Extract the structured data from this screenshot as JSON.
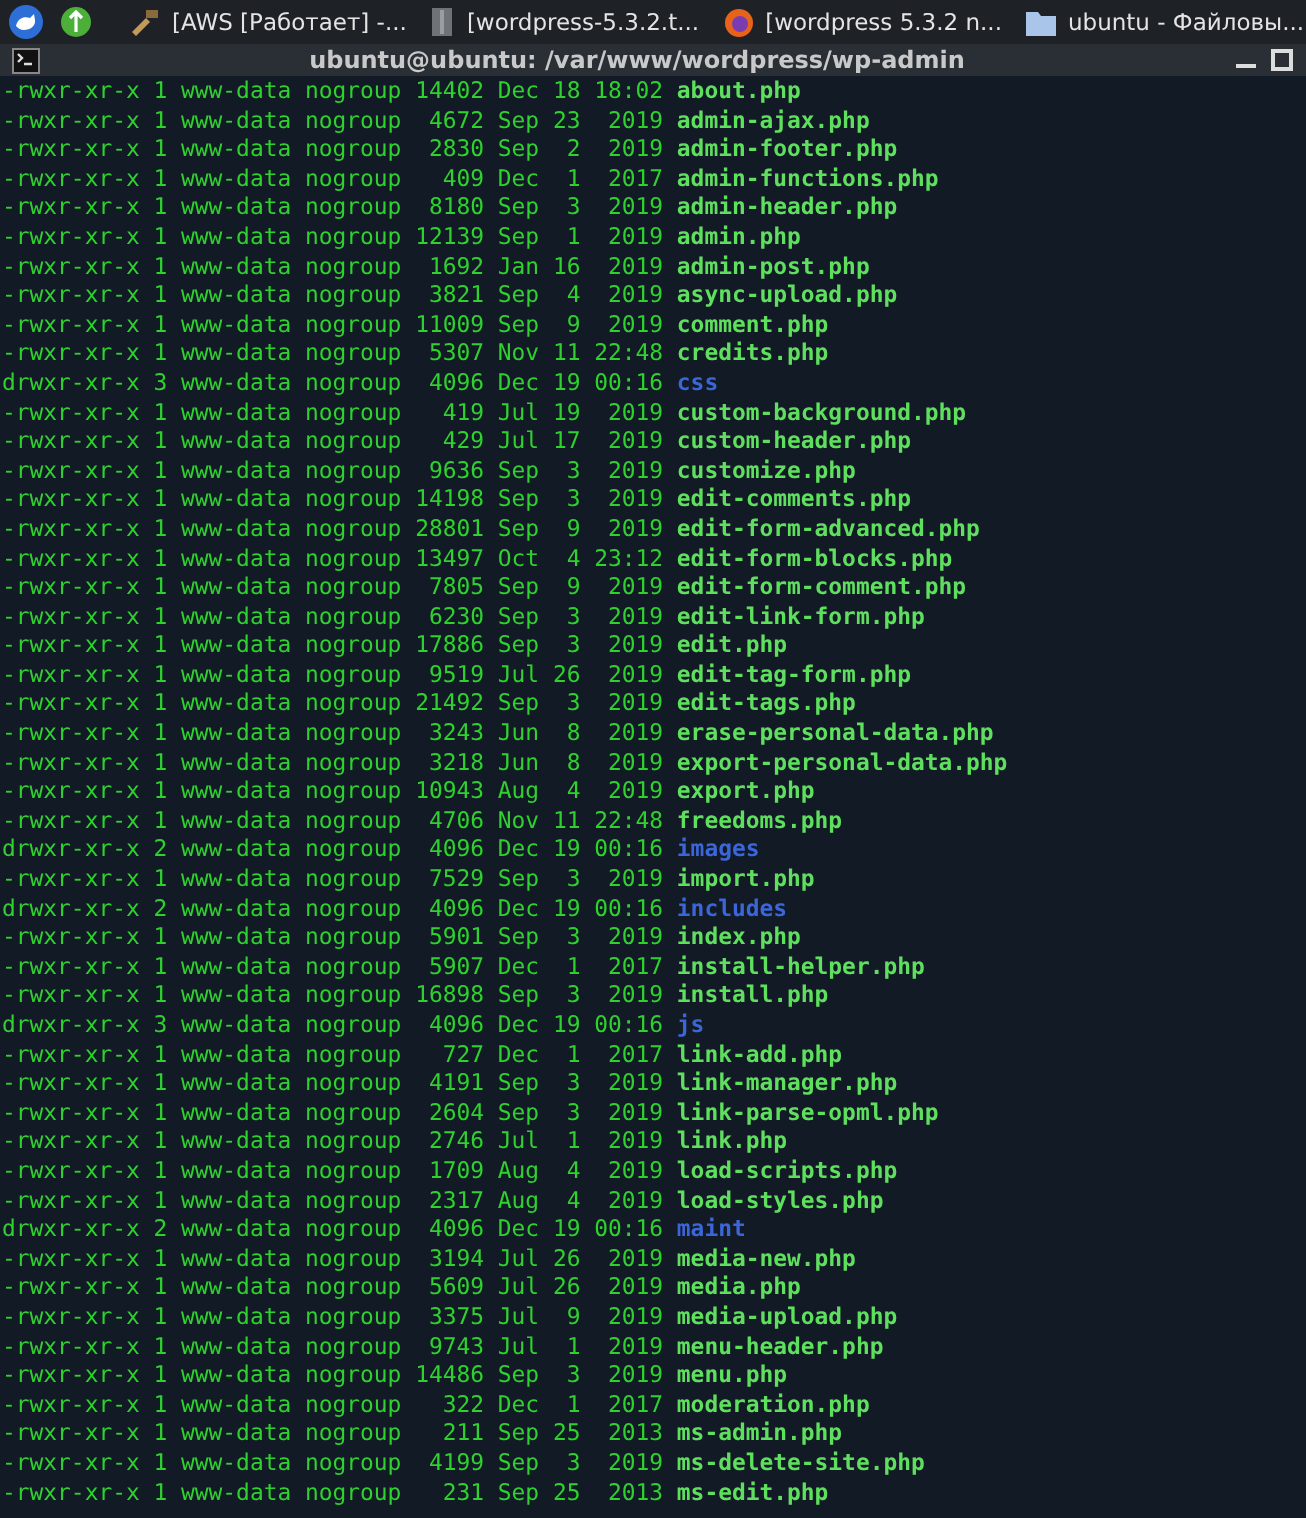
{
  "taskbar": {
    "tasks": [
      {
        "label": "[AWS [Работает] -...",
        "kind": "tool"
      },
      {
        "label": "[wordpress-5.3.2.t...",
        "kind": "archive"
      },
      {
        "label": "[wordpress 5.3.2 n...",
        "kind": "browser"
      },
      {
        "label": "ubuntu - Файловы...",
        "kind": "folder"
      }
    ]
  },
  "terminal": {
    "title": "ubuntu@ubuntu: /var/www/wordpress/wp-admin",
    "lines": [
      {
        "meta": "-rwxr-xr-x 1 www-data nogroup 14402 Dec 18 18:02",
        "name": "about.php",
        "kind": "file"
      },
      {
        "meta": "-rwxr-xr-x 1 www-data nogroup  4672 Sep 23  2019",
        "name": "admin-ajax.php",
        "kind": "file"
      },
      {
        "meta": "-rwxr-xr-x 1 www-data nogroup  2830 Sep  2  2019",
        "name": "admin-footer.php",
        "kind": "file"
      },
      {
        "meta": "-rwxr-xr-x 1 www-data nogroup   409 Dec  1  2017",
        "name": "admin-functions.php",
        "kind": "file"
      },
      {
        "meta": "-rwxr-xr-x 1 www-data nogroup  8180 Sep  3  2019",
        "name": "admin-header.php",
        "kind": "file"
      },
      {
        "meta": "-rwxr-xr-x 1 www-data nogroup 12139 Sep  1  2019",
        "name": "admin.php",
        "kind": "file"
      },
      {
        "meta": "-rwxr-xr-x 1 www-data nogroup  1692 Jan 16  2019",
        "name": "admin-post.php",
        "kind": "file"
      },
      {
        "meta": "-rwxr-xr-x 1 www-data nogroup  3821 Sep  4  2019",
        "name": "async-upload.php",
        "kind": "file"
      },
      {
        "meta": "-rwxr-xr-x 1 www-data nogroup 11009 Sep  9  2019",
        "name": "comment.php",
        "kind": "file"
      },
      {
        "meta": "-rwxr-xr-x 1 www-data nogroup  5307 Nov 11 22:48",
        "name": "credits.php",
        "kind": "file"
      },
      {
        "meta": "drwxr-xr-x 3 www-data nogroup  4096 Dec 19 00:16",
        "name": "css",
        "kind": "dir"
      },
      {
        "meta": "-rwxr-xr-x 1 www-data nogroup   419 Jul 19  2019",
        "name": "custom-background.php",
        "kind": "file"
      },
      {
        "meta": "-rwxr-xr-x 1 www-data nogroup   429 Jul 17  2019",
        "name": "custom-header.php",
        "kind": "file"
      },
      {
        "meta": "-rwxr-xr-x 1 www-data nogroup  9636 Sep  3  2019",
        "name": "customize.php",
        "kind": "file"
      },
      {
        "meta": "-rwxr-xr-x 1 www-data nogroup 14198 Sep  3  2019",
        "name": "edit-comments.php",
        "kind": "file"
      },
      {
        "meta": "-rwxr-xr-x 1 www-data nogroup 28801 Sep  9  2019",
        "name": "edit-form-advanced.php",
        "kind": "file"
      },
      {
        "meta": "-rwxr-xr-x 1 www-data nogroup 13497 Oct  4 23:12",
        "name": "edit-form-blocks.php",
        "kind": "file"
      },
      {
        "meta": "-rwxr-xr-x 1 www-data nogroup  7805 Sep  9  2019",
        "name": "edit-form-comment.php",
        "kind": "file"
      },
      {
        "meta": "-rwxr-xr-x 1 www-data nogroup  6230 Sep  3  2019",
        "name": "edit-link-form.php",
        "kind": "file"
      },
      {
        "meta": "-rwxr-xr-x 1 www-data nogroup 17886 Sep  3  2019",
        "name": "edit.php",
        "kind": "file"
      },
      {
        "meta": "-rwxr-xr-x 1 www-data nogroup  9519 Jul 26  2019",
        "name": "edit-tag-form.php",
        "kind": "file"
      },
      {
        "meta": "-rwxr-xr-x 1 www-data nogroup 21492 Sep  3  2019",
        "name": "edit-tags.php",
        "kind": "file"
      },
      {
        "meta": "-rwxr-xr-x 1 www-data nogroup  3243 Jun  8  2019",
        "name": "erase-personal-data.php",
        "kind": "file"
      },
      {
        "meta": "-rwxr-xr-x 1 www-data nogroup  3218 Jun  8  2019",
        "name": "export-personal-data.php",
        "kind": "file"
      },
      {
        "meta": "-rwxr-xr-x 1 www-data nogroup 10943 Aug  4  2019",
        "name": "export.php",
        "kind": "file"
      },
      {
        "meta": "-rwxr-xr-x 1 www-data nogroup  4706 Nov 11 22:48",
        "name": "freedoms.php",
        "kind": "file"
      },
      {
        "meta": "drwxr-xr-x 2 www-data nogroup  4096 Dec 19 00:16",
        "name": "images",
        "kind": "dir"
      },
      {
        "meta": "-rwxr-xr-x 1 www-data nogroup  7529 Sep  3  2019",
        "name": "import.php",
        "kind": "file"
      },
      {
        "meta": "drwxr-xr-x 2 www-data nogroup  4096 Dec 19 00:16",
        "name": "includes",
        "kind": "dir"
      },
      {
        "meta": "-rwxr-xr-x 1 www-data nogroup  5901 Sep  3  2019",
        "name": "index.php",
        "kind": "file"
      },
      {
        "meta": "-rwxr-xr-x 1 www-data nogroup  5907 Dec  1  2017",
        "name": "install-helper.php",
        "kind": "file"
      },
      {
        "meta": "-rwxr-xr-x 1 www-data nogroup 16898 Sep  3  2019",
        "name": "install.php",
        "kind": "file"
      },
      {
        "meta": "drwxr-xr-x 3 www-data nogroup  4096 Dec 19 00:16",
        "name": "js",
        "kind": "dir"
      },
      {
        "meta": "-rwxr-xr-x 1 www-data nogroup   727 Dec  1  2017",
        "name": "link-add.php",
        "kind": "file"
      },
      {
        "meta": "-rwxr-xr-x 1 www-data nogroup  4191 Sep  3  2019",
        "name": "link-manager.php",
        "kind": "file"
      },
      {
        "meta": "-rwxr-xr-x 1 www-data nogroup  2604 Sep  3  2019",
        "name": "link-parse-opml.php",
        "kind": "file"
      },
      {
        "meta": "-rwxr-xr-x 1 www-data nogroup  2746 Jul  1  2019",
        "name": "link.php",
        "kind": "file"
      },
      {
        "meta": "-rwxr-xr-x 1 www-data nogroup  1709 Aug  4  2019",
        "name": "load-scripts.php",
        "kind": "file"
      },
      {
        "meta": "-rwxr-xr-x 1 www-data nogroup  2317 Aug  4  2019",
        "name": "load-styles.php",
        "kind": "file"
      },
      {
        "meta": "drwxr-xr-x 2 www-data nogroup  4096 Dec 19 00:16",
        "name": "maint",
        "kind": "dir"
      },
      {
        "meta": "-rwxr-xr-x 1 www-data nogroup  3194 Jul 26  2019",
        "name": "media-new.php",
        "kind": "file"
      },
      {
        "meta": "-rwxr-xr-x 1 www-data nogroup  5609 Jul 26  2019",
        "name": "media.php",
        "kind": "file"
      },
      {
        "meta": "-rwxr-xr-x 1 www-data nogroup  3375 Jul  9  2019",
        "name": "media-upload.php",
        "kind": "file"
      },
      {
        "meta": "-rwxr-xr-x 1 www-data nogroup  9743 Jul  1  2019",
        "name": "menu-header.php",
        "kind": "file"
      },
      {
        "meta": "-rwxr-xr-x 1 www-data nogroup 14486 Sep  3  2019",
        "name": "menu.php",
        "kind": "file"
      },
      {
        "meta": "-rwxr-xr-x 1 www-data nogroup   322 Dec  1  2017",
        "name": "moderation.php",
        "kind": "file"
      },
      {
        "meta": "-rwxr-xr-x 1 www-data nogroup   211 Sep 25  2013",
        "name": "ms-admin.php",
        "kind": "file"
      },
      {
        "meta": "-rwxr-xr-x 1 www-data nogroup  4199 Sep  3  2019",
        "name": "ms-delete-site.php",
        "kind": "file"
      },
      {
        "meta": "-rwxr-xr-x 1 www-data nogroup   231 Sep 25  2013",
        "name": "ms-edit.php",
        "kind": "file"
      }
    ]
  }
}
